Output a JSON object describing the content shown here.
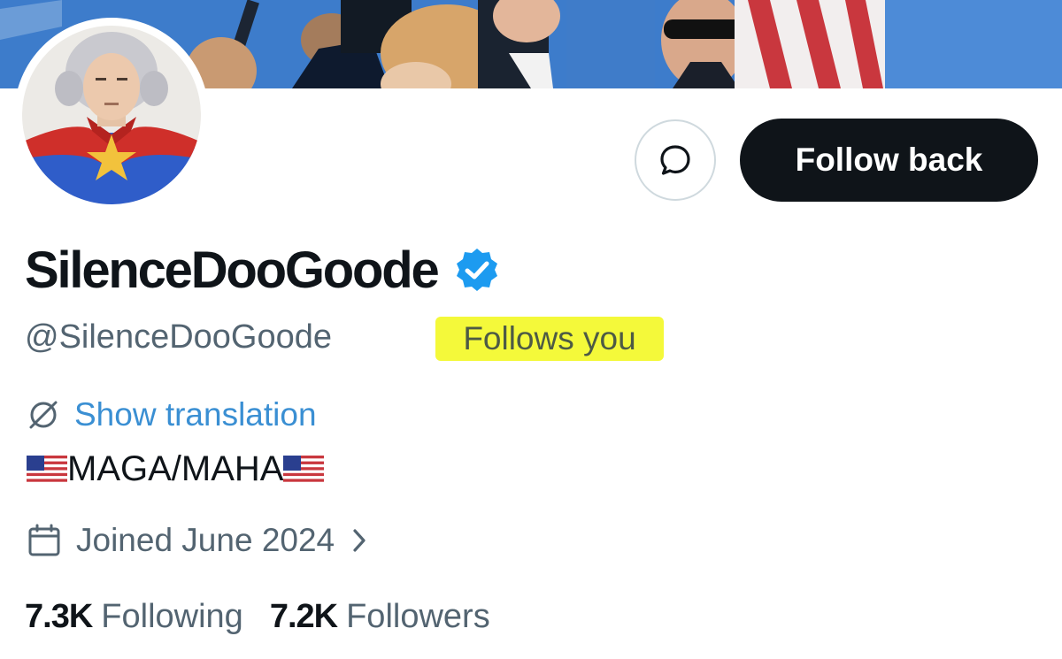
{
  "profile": {
    "display_name": "SilenceDooGoode",
    "handle": "@SilenceDooGoode",
    "follows_you": "Follows you",
    "verified": true
  },
  "actions": {
    "follow_back_label": "Follow back",
    "message_icon": "message-bubble-icon"
  },
  "bio": {
    "translation_label": "Show translation",
    "translation_icon": "globe-slash-icon",
    "text": "MAGA/MAHA",
    "flag_emoji": "🇺🇸"
  },
  "joined": {
    "label": "Joined June 2024",
    "icon": "calendar-icon"
  },
  "stats": {
    "following_count": "7.3K",
    "following_label": "Following",
    "followers_count": "7.2K",
    "followers_label": "Followers"
  },
  "colors": {
    "accent": "#1d9bf0",
    "highlight": "#f4f93a",
    "button_bg": "#0f1419"
  }
}
